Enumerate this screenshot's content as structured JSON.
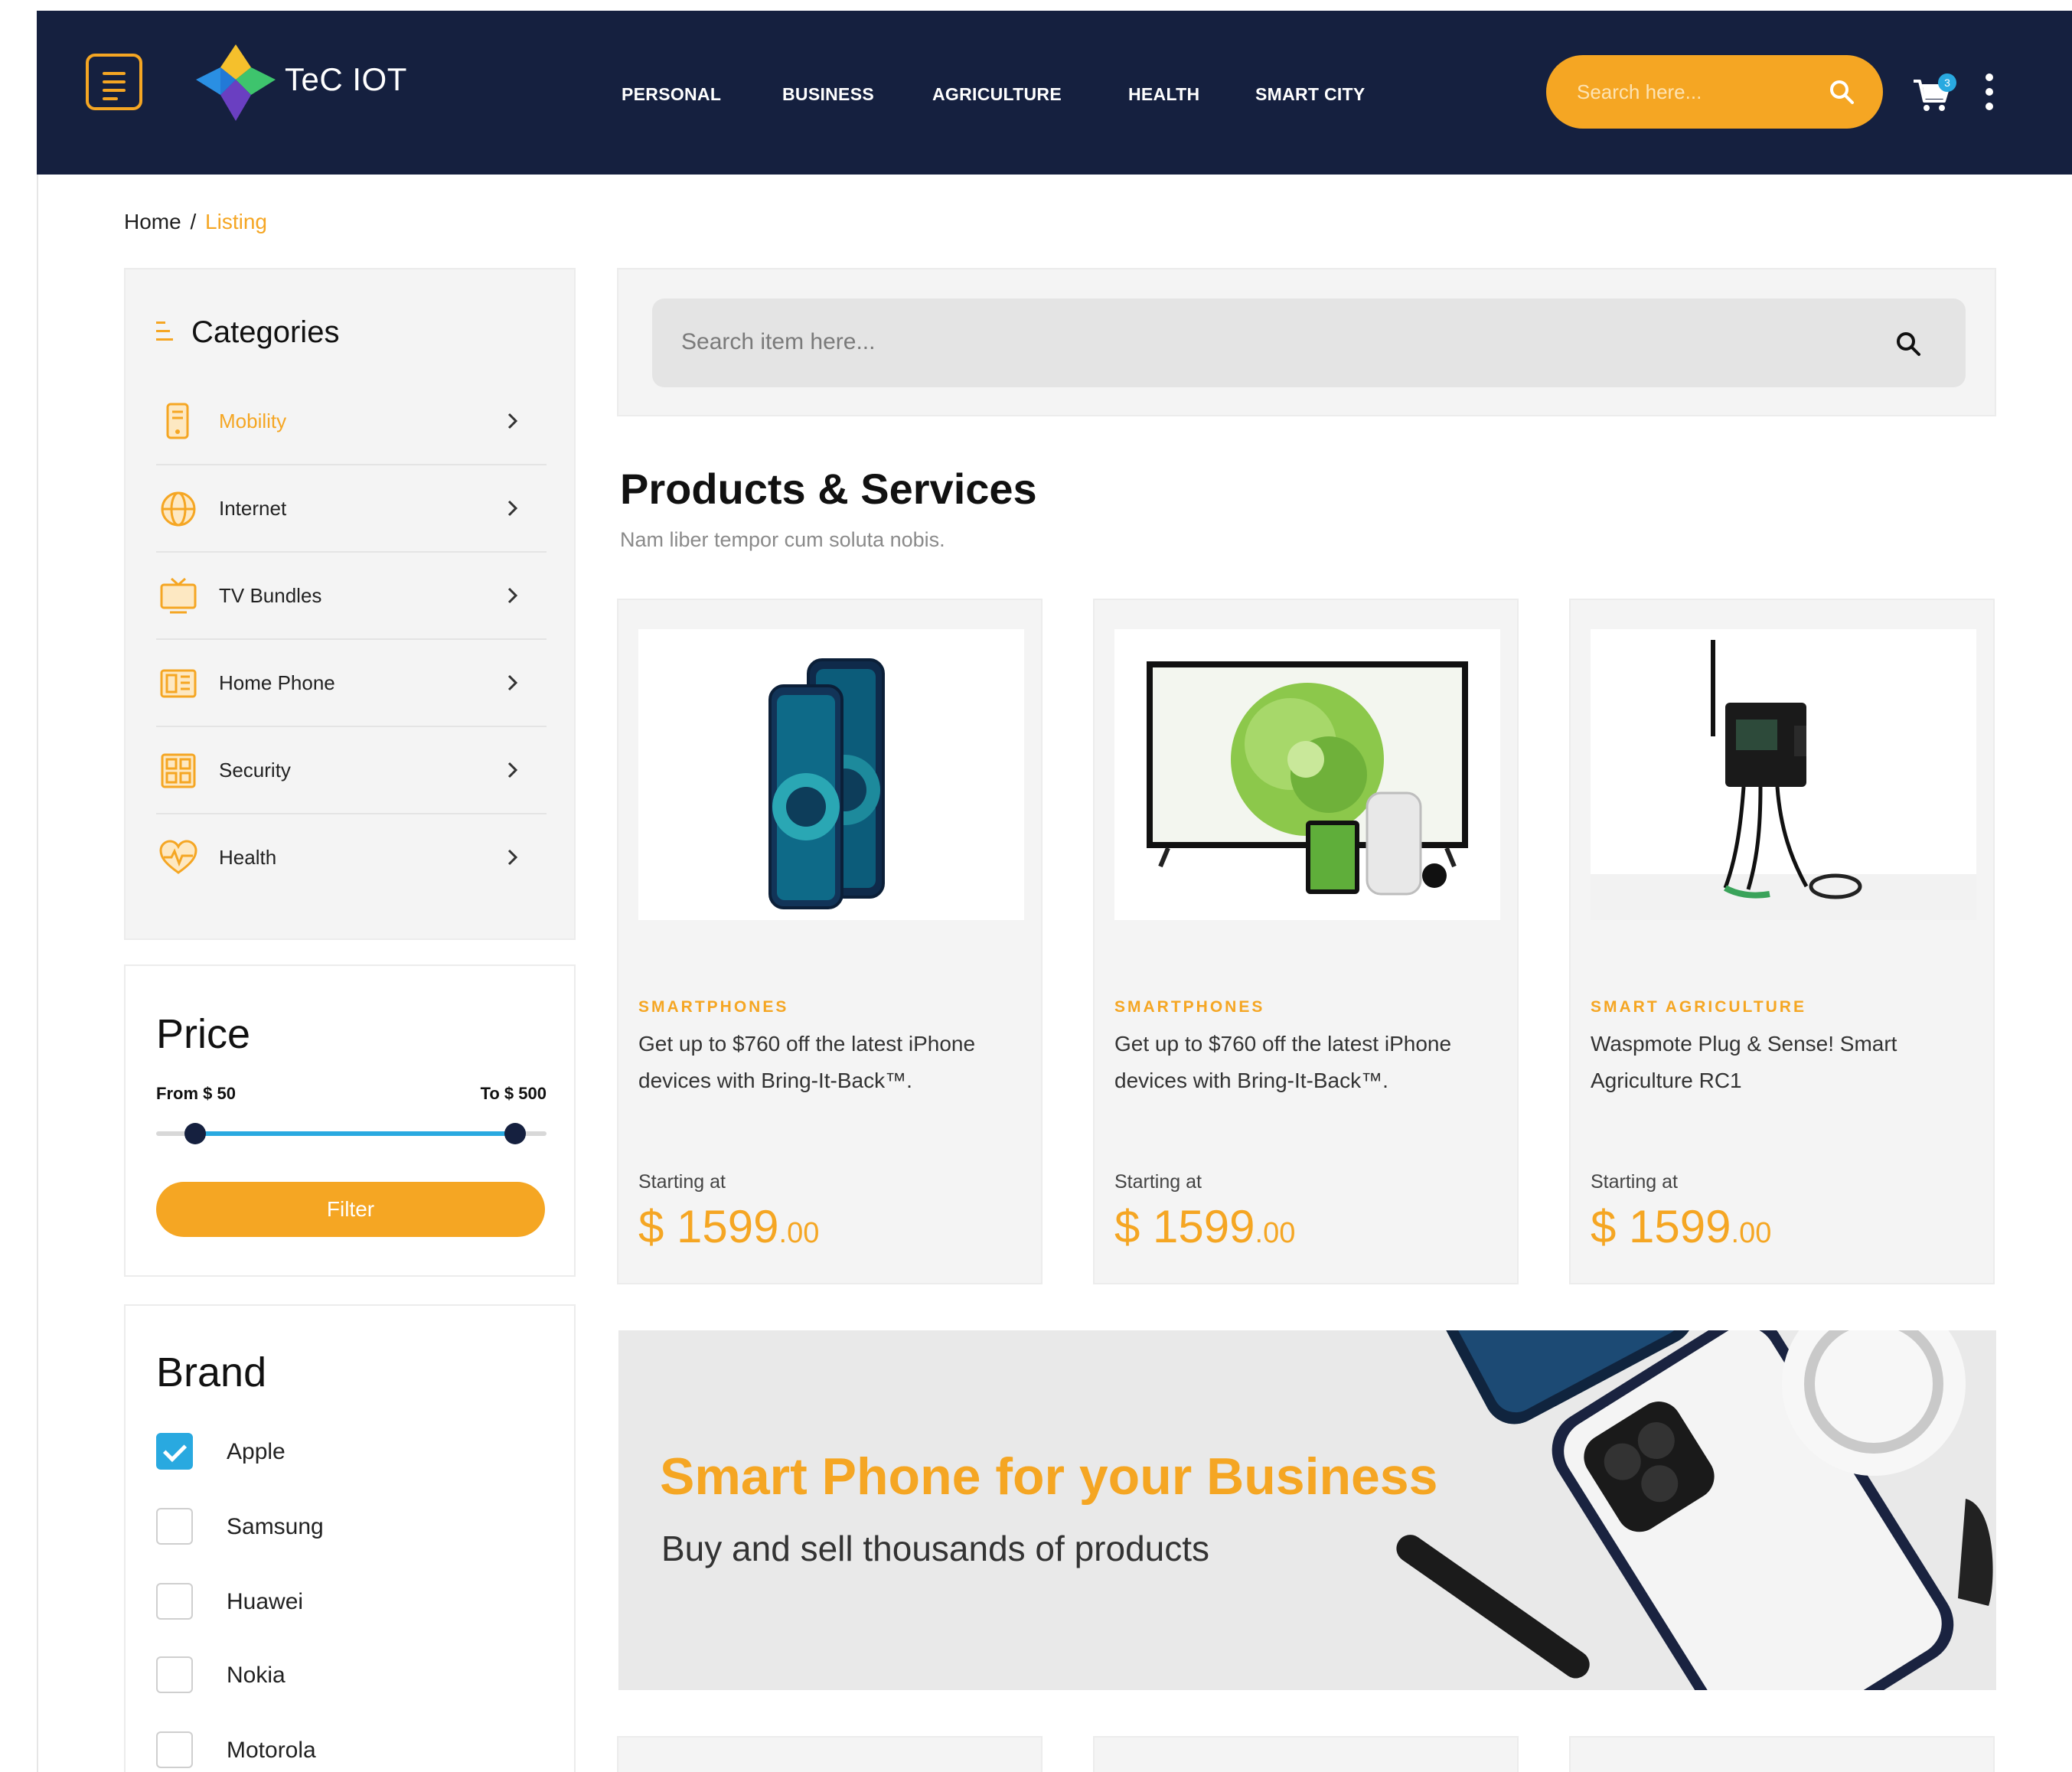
{
  "header": {
    "brand": "TeC IOT",
    "nav": [
      "PERSONAL",
      "BUSINESS",
      "AGRICULTURE",
      "HEALTH",
      "SMART CITY"
    ],
    "search_placeholder": "Search here...",
    "cart_count": "3"
  },
  "breadcrumb": {
    "home": "Home",
    "separator": "/",
    "current": "Listing"
  },
  "sidebar": {
    "categories_title": "Categories",
    "categories": [
      {
        "label": "Mobility",
        "icon": "mobile-icon",
        "active": true
      },
      {
        "label": "Internet",
        "icon": "globe-icon",
        "active": false
      },
      {
        "label": "TV Bundles",
        "icon": "tv-icon",
        "active": false
      },
      {
        "label": "Home Phone",
        "icon": "home-phone-icon",
        "active": false
      },
      {
        "label": "Security",
        "icon": "security-icon",
        "active": false
      },
      {
        "label": "Health",
        "icon": "heart-pulse-icon",
        "active": false
      }
    ],
    "price": {
      "title": "Price",
      "from_label": "From $ 50",
      "to_label": "To  $ 500",
      "range_min": 0.1,
      "range_max": 0.92,
      "filter_label": "Filter"
    },
    "brand": {
      "title": "Brand",
      "items": [
        {
          "label": "Apple",
          "checked": true
        },
        {
          "label": "Samsung",
          "checked": false
        },
        {
          "label": "Huawei",
          "checked": false
        },
        {
          "label": "Nokia",
          "checked": false
        },
        {
          "label": "Motorola",
          "checked": false
        }
      ]
    }
  },
  "main": {
    "search_placeholder": "Search item here...",
    "title": "Products & Services",
    "subtitle": "Nam liber tempor cum soluta nobis.",
    "products": [
      {
        "category": "SMARTPHONES",
        "description": "Get up to $760 off the latest iPhone devices with Bring-It-Back™.",
        "starting": "Starting at",
        "price_main": "$ 1599",
        "price_cents": ".00",
        "image": "smartphone-image"
      },
      {
        "category": "SMARTPHONES",
        "description": "Get up to $760 off the latest iPhone devices with Bring-It-Back™.",
        "starting": "Starting at",
        "price_main": "$ 1599",
        "price_cents": ".00",
        "image": "tv-devices-image"
      },
      {
        "category": "SMART AGRICULTURE",
        "description": "Waspmote Plug & Sense! Smart Agriculture RC1",
        "starting": "Starting at",
        "price_main": "$ 1599",
        "price_cents": ".00",
        "image": "sensor-device-image"
      }
    ],
    "banner": {
      "title": "Smart Phone for your Business",
      "subtitle": "Buy and sell thousands of products"
    }
  },
  "colors": {
    "navy": "#15203f",
    "accent": "#f5a623",
    "blue": "#29a9e0"
  }
}
